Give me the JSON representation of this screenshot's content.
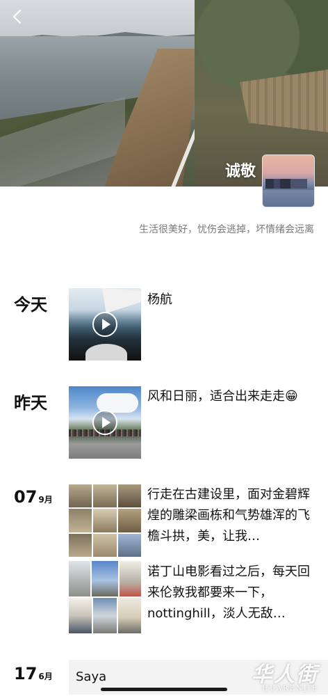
{
  "profile": {
    "name": "诚敬",
    "signature": "生活很美好，忧伤会逃掉，坏情绪会远离"
  },
  "icons": {
    "back": "chevron-left-icon",
    "play": "play-icon"
  },
  "timeline": [
    {
      "label": "今天",
      "text": "杨航",
      "media": "video"
    },
    {
      "label": "昨天",
      "text": "风和日丽，适合出来走走😁",
      "media": "video"
    },
    {
      "day": "07",
      "month": "9月",
      "entries": [
        {
          "text": "行走在古建设里，面对金碧辉煌的雕梁画栋和气势雄浑的飞檐斗拱，美，让我…",
          "media": "photo-grid-9"
        },
        {
          "text": "诺丁山电影看过之后，每天回来伦敦我都要来一下，nottinghill，淡人无敌…",
          "media": "photo-grid-4"
        }
      ]
    },
    {
      "day": "17",
      "month": "6月",
      "text": "Saya",
      "media": "text"
    }
  ],
  "watermark": {
    "cn": "华人街",
    "en": "HUARENJIE"
  }
}
